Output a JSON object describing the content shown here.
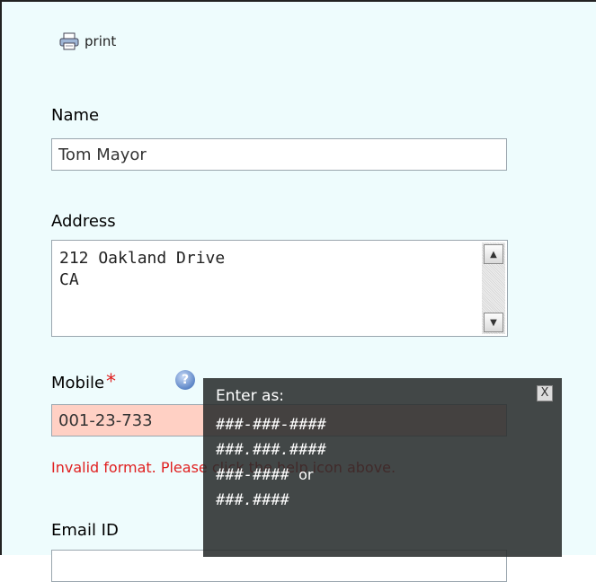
{
  "toolbar": {
    "print_label": "print",
    "print_icon": "printer-icon"
  },
  "form": {
    "name": {
      "label": "Name",
      "value": "Tom Mayor"
    },
    "address": {
      "label": "Address",
      "value": "212 Oakland Drive\nCA"
    },
    "mobile": {
      "label": "Mobile",
      "required_mark": "*",
      "value": "001-23-733",
      "error": "Invalid format. Please click the help icon above."
    },
    "email": {
      "label": "Email ID"
    }
  },
  "tooltip": {
    "title": "Enter as:",
    "formats": [
      "###-###-####",
      "###.###.####",
      "###-####",
      "###.####"
    ],
    "or_text": "or",
    "close_label": "X"
  },
  "colors": {
    "panel_bg": "#eefcfd",
    "error": "#e02020",
    "invalid_field_bg": "#ffd0c4",
    "tooltip_bg": "#2c3030"
  }
}
